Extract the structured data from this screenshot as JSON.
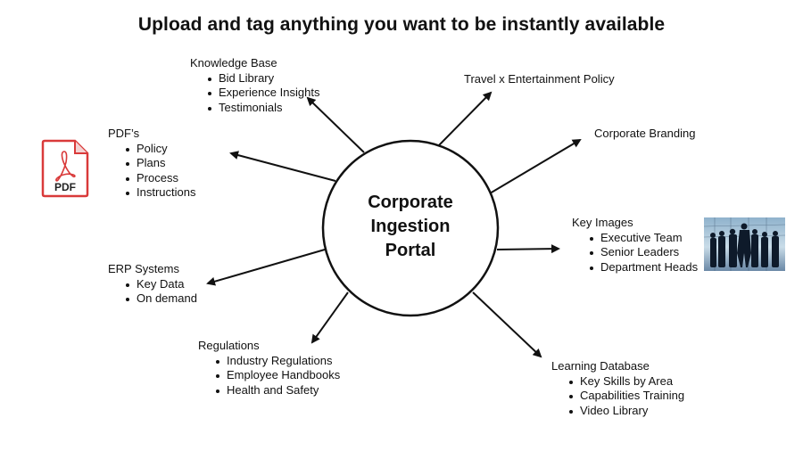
{
  "title": "Upload and tag anything you want to be instantly available",
  "hub": {
    "line1": "Corporate",
    "line2": "Ingestion",
    "line3": "Portal"
  },
  "nodes": {
    "knowledge_base": {
      "heading": "Knowledge Base",
      "items": [
        "Bid Library",
        "Experience Insights",
        "Testimonials"
      ]
    },
    "travel": {
      "heading": "Travel x Entertainment Policy"
    },
    "branding": {
      "heading": "Corporate Branding"
    },
    "pdfs": {
      "heading": "PDF’s",
      "items": [
        "Policy",
        "Plans",
        "Process",
        "Instructions"
      ]
    },
    "key_images": {
      "heading": "Key Images",
      "items": [
        "Executive Team",
        "Senior Leaders",
        "Department Heads"
      ]
    },
    "erp": {
      "heading": "ERP Systems",
      "items": [
        "Key Data",
        "On demand"
      ]
    },
    "regulations": {
      "heading": "Regulations",
      "items": [
        "Industry Regulations",
        "Employee Handbooks",
        "Health and Safety"
      ]
    },
    "learning": {
      "heading": "Learning Database",
      "items": [
        "Key Skills by Area",
        "Capabilities Training",
        "Video Library"
      ]
    }
  },
  "icons": {
    "pdf": {
      "name": "pdf-file-icon",
      "label": "PDF",
      "color": "#d93a3a"
    },
    "photo": "executive-team-photo"
  }
}
